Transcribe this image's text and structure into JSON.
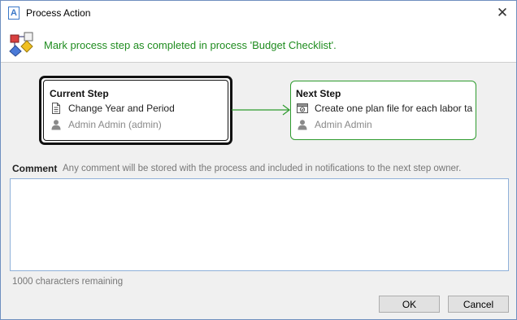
{
  "window": {
    "title": "Process Action",
    "app_icon_letter": "A",
    "close_glyph": "✕"
  },
  "header": {
    "message": "Mark process step as completed in process 'Budget Checklist'."
  },
  "current_step": {
    "title": "Current Step",
    "step_name": "Change Year and Period",
    "owner": "Admin Admin (admin)"
  },
  "next_step": {
    "title": "Next Step",
    "step_name": "Create one plan file for each labor ta",
    "owner": "Admin Admin"
  },
  "comment": {
    "label": "Comment",
    "hint": "Any comment will be stored with the process and included in notifications to the next step owner.",
    "value": "",
    "chars_remaining": "1000 characters remaining"
  },
  "buttons": {
    "ok": "OK",
    "cancel": "Cancel"
  },
  "colors": {
    "success_green": "#1f8c1f",
    "next_step_border": "#2e9b2e"
  }
}
